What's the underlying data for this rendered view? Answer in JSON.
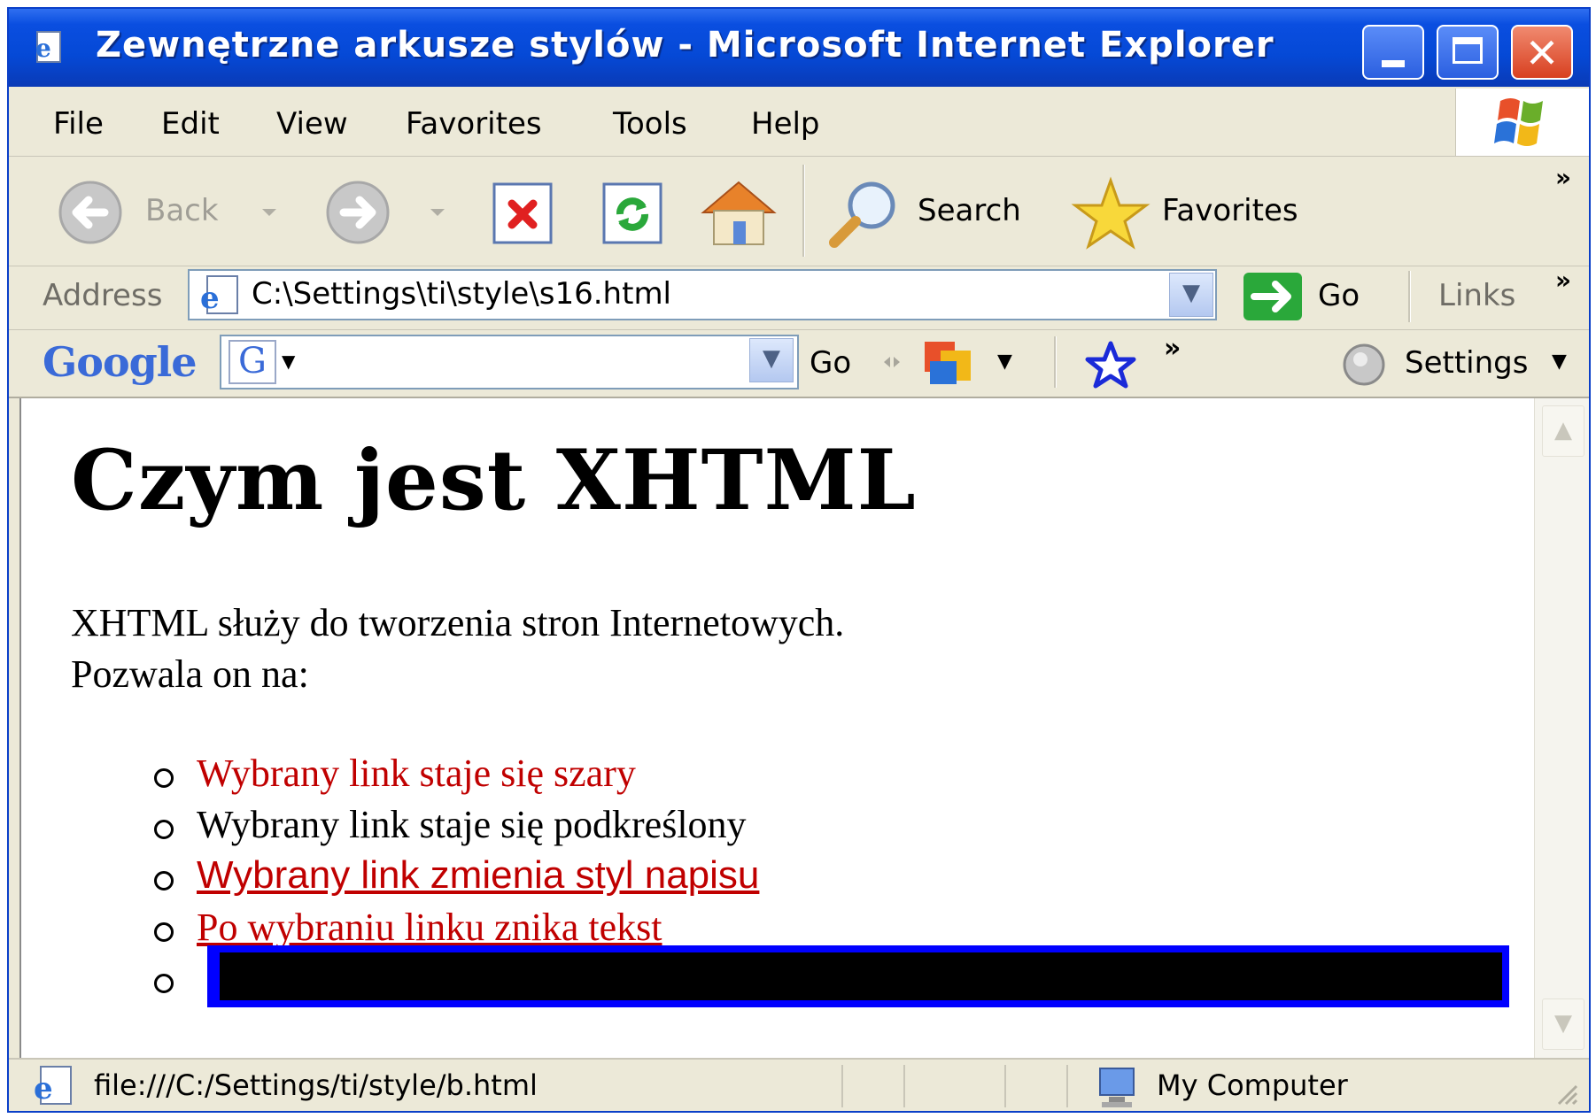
{
  "window": {
    "title": "Zewnętrzne arkusze stylów - Microsoft Internet Explorer",
    "close_glyph": "✕"
  },
  "menu": {
    "file": "File",
    "edit": "Edit",
    "view": "View",
    "favorites": "Favorites",
    "tools": "Tools",
    "help": "Help"
  },
  "toolbar": {
    "back": "Back",
    "search": "Search",
    "favorites": "Favorites",
    "more": "»"
  },
  "address": {
    "label": "Address",
    "value": "C:\\Settings\\ti\\style\\s16.html",
    "go": "Go",
    "links": "Links",
    "more": "»"
  },
  "google": {
    "logo": "Google",
    "go": "Go",
    "more": "»",
    "settings": "Settings"
  },
  "page": {
    "heading": "Czym jest XHTML",
    "para_line1": "XHTML służy do tworzenia stron Internetowych.",
    "para_line2": "Pozwala on na:",
    "items": [
      "Wybrany link staje się szary",
      "Wybrany link staje się podkreślony",
      "Wybrany link zmienia styl napisu",
      "Po wybraniu linku znika tekst"
    ]
  },
  "status": {
    "url": "file:///C:/Settings/ti/style/b.html",
    "zone": "My Computer"
  },
  "colors": {
    "titlebar": "#0549d6",
    "link_red": "#c00000",
    "hover_border": "#0000ff"
  }
}
